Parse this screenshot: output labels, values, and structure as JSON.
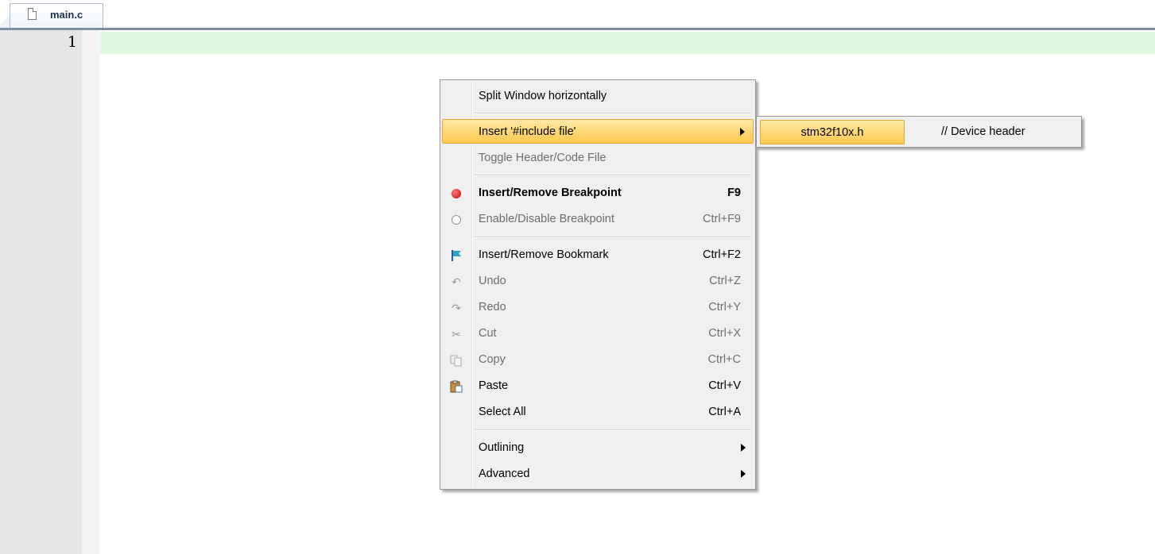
{
  "editor": {
    "tab_label": "main.c",
    "line_numbers": [
      "1"
    ]
  },
  "context_menu": {
    "items": [
      {
        "label": "Split Window horizontally",
        "shortcut": "",
        "icon": ""
      },
      {
        "label": "Insert '#include file'",
        "shortcut": "",
        "icon": "",
        "submenu": true
      },
      {
        "label": "Toggle Header/Code File",
        "shortcut": "",
        "icon": ""
      },
      {
        "label": "Insert/Remove Breakpoint",
        "shortcut": "F9",
        "icon": "breakpoint-icon"
      },
      {
        "label": "Enable/Disable Breakpoint",
        "shortcut": "Ctrl+F9",
        "icon": "breakpoint-disabled-icon"
      },
      {
        "label": "Insert/Remove Bookmark",
        "shortcut": "Ctrl+F2",
        "icon": "bookmark-flag-icon"
      },
      {
        "label": "Undo",
        "shortcut": "Ctrl+Z",
        "icon": "undo-icon"
      },
      {
        "label": "Redo",
        "shortcut": "Ctrl+Y",
        "icon": "redo-icon"
      },
      {
        "label": "Cut",
        "shortcut": "Ctrl+X",
        "icon": "scissors-icon"
      },
      {
        "label": "Copy",
        "shortcut": "Ctrl+C",
        "icon": "copy-icon"
      },
      {
        "label": "Paste",
        "shortcut": "Ctrl+V",
        "icon": "paste-icon"
      },
      {
        "label": "Select All",
        "shortcut": "Ctrl+A",
        "icon": ""
      },
      {
        "label": "Outlining",
        "shortcut": "",
        "icon": "",
        "submenu": true
      },
      {
        "label": "Advanced",
        "shortcut": "",
        "icon": "",
        "submenu": true
      }
    ]
  },
  "include_submenu": {
    "file": "stm32f10x.h",
    "comment": "// Device header"
  },
  "colors": {
    "highlight": "#ffd56f",
    "current_line": "#e1f8e1",
    "breakpoint": "#c40000"
  }
}
